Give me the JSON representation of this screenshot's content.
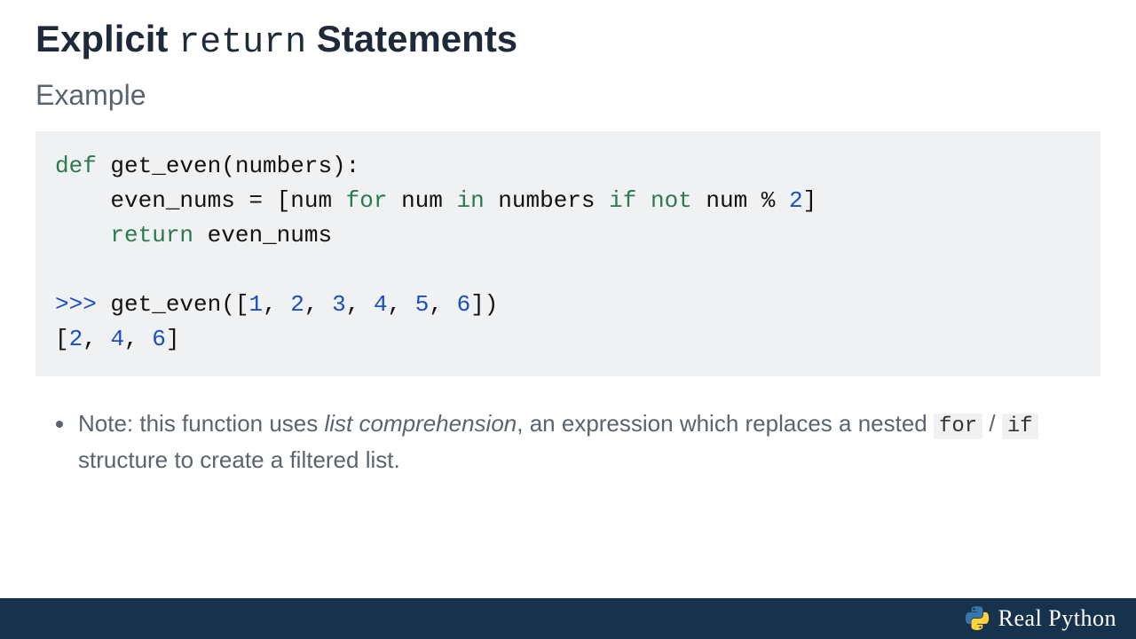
{
  "title": {
    "part1": "Explicit ",
    "code": "return",
    "part2": "  Statements"
  },
  "subtitle": "Example",
  "code": {
    "l1_def": "def",
    "l1_rest": " get_even(numbers):",
    "l2_a": "    even_nums = [num ",
    "l2_for": "for",
    "l2_b": " num ",
    "l2_in": "in",
    "l2_c": " numbers ",
    "l2_if": "if",
    "l2_d": " ",
    "l2_not": "not",
    "l2_e": " num % ",
    "l2_two": "2",
    "l2_f": "]",
    "l3_indent": "    ",
    "l3_return": "return",
    "l3_rest": " even_nums",
    "blank": "",
    "p_prompt": ">>>",
    "p_call_a": " get_even([",
    "p_n1": "1",
    "p_c": ", ",
    "p_n2": "2",
    "p_n3": "3",
    "p_n4": "4",
    "p_n5": "5",
    "p_n6": "6",
    "p_call_b": "])",
    "out_a": "[",
    "out_n1": "2",
    "out_c": ", ",
    "out_n2": "4",
    "out_n3": "6",
    "out_b": "]"
  },
  "note": {
    "a": "Note: this function uses ",
    "em": "list comprehension",
    "b": ", an expression which replaces a nested ",
    "mono1": "for",
    "slash": " / ",
    "mono2": "if",
    "c": " structure to create a filtered list."
  },
  "footer": {
    "brand": "Real Python"
  }
}
